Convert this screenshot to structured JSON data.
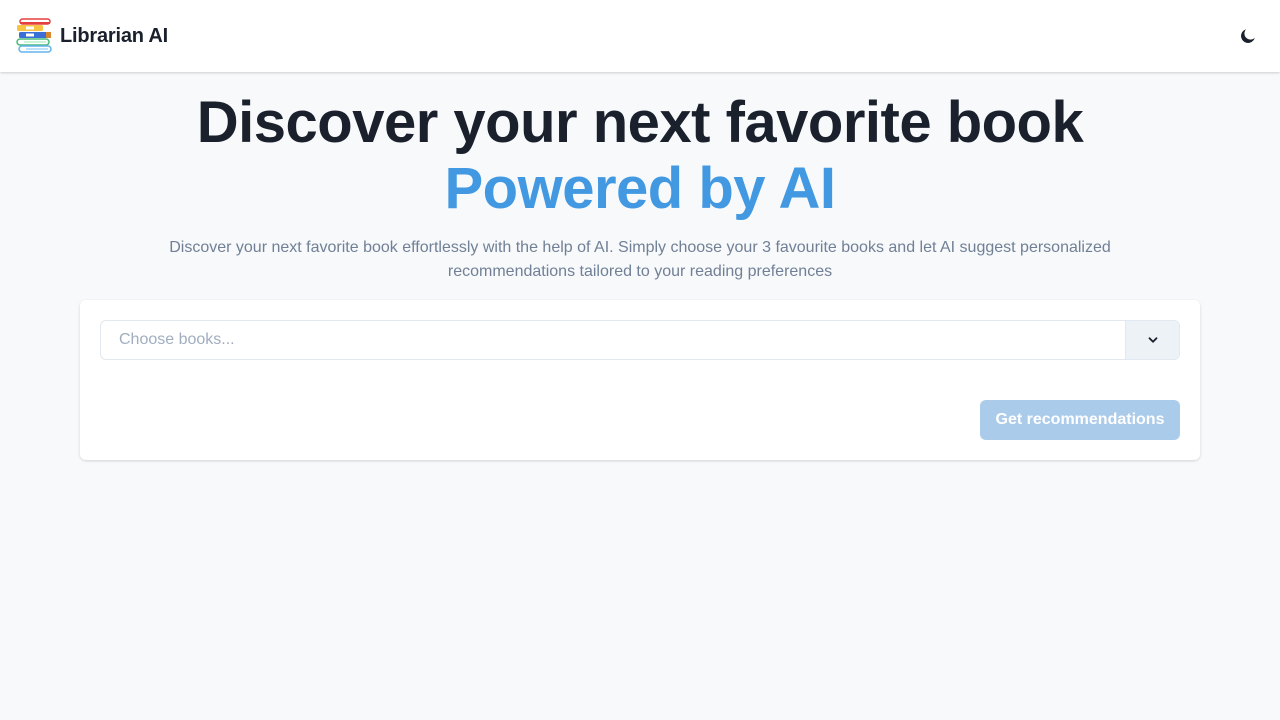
{
  "navbar": {
    "brand_name": "Librarian AI",
    "logo_icon": "stacked-books-icon",
    "theme_toggle_icon": "moon-icon"
  },
  "hero": {
    "title_line1": "Discover your next favorite book",
    "title_line2": "Powered by AI",
    "description": "Discover your next favorite book effortlessly with the help of AI. Simply choose your 3 favourite books and let AI suggest personalized recommendations tailored to your reading preferences"
  },
  "form": {
    "book_select": {
      "placeholder": "Choose books...",
      "value": "",
      "toggle_icon": "chevron-down-icon"
    },
    "submit_label": "Get recommendations",
    "submit_disabled": true
  },
  "colors": {
    "accent": "#4299e1",
    "heading": "#1a202c",
    "muted_text": "#718096",
    "background": "#f7f9fb",
    "button_disabled": "#abcbea"
  }
}
